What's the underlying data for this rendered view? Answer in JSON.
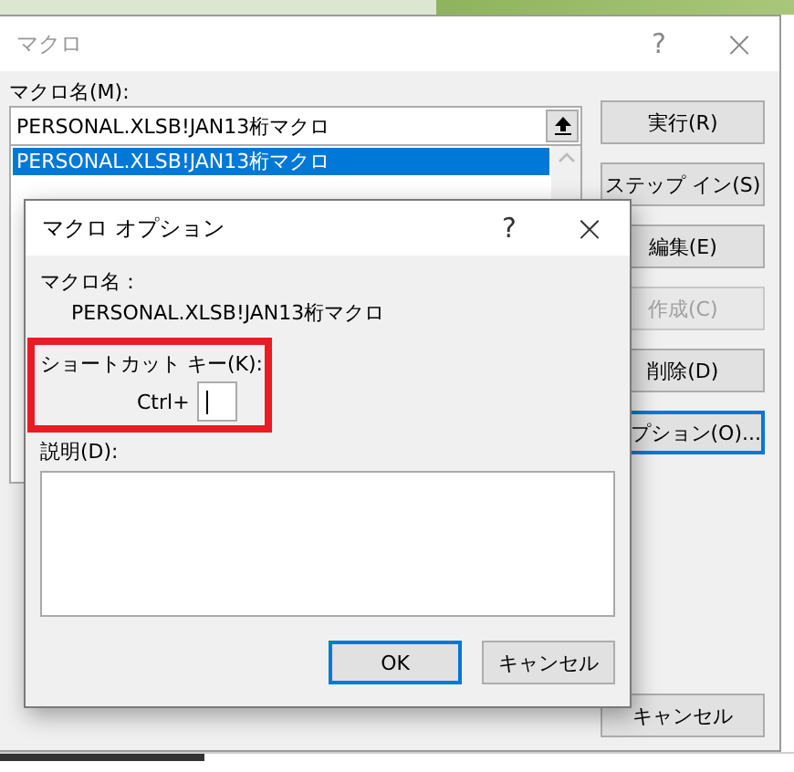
{
  "background_window": {
    "title": "マクロ",
    "help": "?",
    "close": "×",
    "macro_name_label": "マクロ名(M):",
    "macro_name_value": "PERSONAL.XLSB!JAN13桁マクロ",
    "macro_list": [
      {
        "name": "PERSONAL.XLSB!JAN13桁マクロ",
        "selected": true
      }
    ],
    "buttons": [
      {
        "label": "実行(R)",
        "disabled": false,
        "focused": false
      },
      {
        "label": "ステップ イン(S)",
        "disabled": false,
        "focused": false
      },
      {
        "label": "編集(E)",
        "disabled": false,
        "focused": false
      },
      {
        "label": "作成(C)",
        "disabled": true,
        "focused": false
      },
      {
        "label": "削除(D)",
        "disabled": false,
        "focused": false
      },
      {
        "label": "プション(O)...",
        "disabled": false,
        "focused": true
      }
    ],
    "cancel_button": "キャンセル"
  },
  "dialog": {
    "title": "マクロ オプション",
    "help": "?",
    "close": "×",
    "macro_name_label": "マクロ名：",
    "macro_name": "PERSONAL.XLSB!JAN13桁マクロ",
    "shortcut_label": "ショートカット キー(K):",
    "shortcut_prefix": "Ctrl+",
    "shortcut_highlighted": true,
    "description_label": "説明(D):",
    "buttons": [
      {
        "label": "OK",
        "focused": true
      },
      {
        "label": "キャンセル",
        "focused": false
      }
    ]
  }
}
